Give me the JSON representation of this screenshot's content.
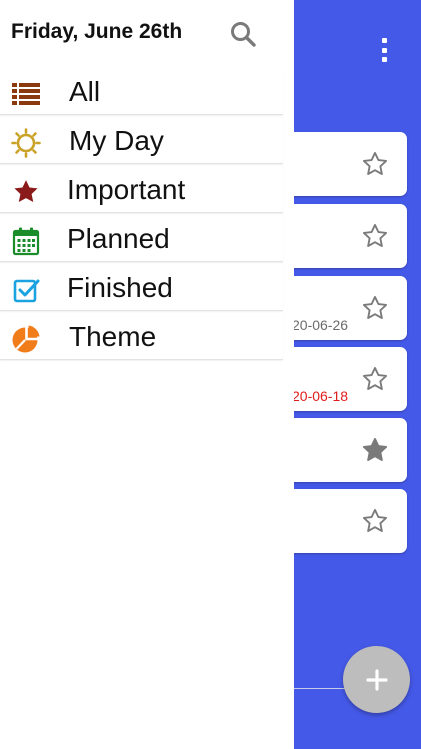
{
  "drawer": {
    "title": "Friday, June 26th",
    "items": [
      {
        "label": "All",
        "icon": "list-icon",
        "color": "#8b3a0f"
      },
      {
        "label": "My Day",
        "icon": "sun-icon",
        "color": "#c9a227"
      },
      {
        "label": "Important",
        "icon": "star-icon",
        "color": "#8b1a1a"
      },
      {
        "label": "Planned",
        "icon": "calendar-icon",
        "color": "#1a8c2a"
      },
      {
        "label": "Finished",
        "icon": "checkbox-icon",
        "color": "#1aa3e0"
      },
      {
        "label": "Theme",
        "icon": "pie-chart-icon",
        "color": "#f07c1a"
      }
    ]
  },
  "background": {
    "accent_color": "#4559e8",
    "tasks": [
      {
        "date": "",
        "starred": false
      },
      {
        "date": "",
        "starred": false
      },
      {
        "date": "20-06-26",
        "starred": false,
        "overdue": false
      },
      {
        "date": "20-06-18",
        "starred": false,
        "overdue": true
      },
      {
        "date": "",
        "starred": true
      },
      {
        "date": "",
        "starred": false
      }
    ],
    "overdue_color": "#e01b1b"
  }
}
